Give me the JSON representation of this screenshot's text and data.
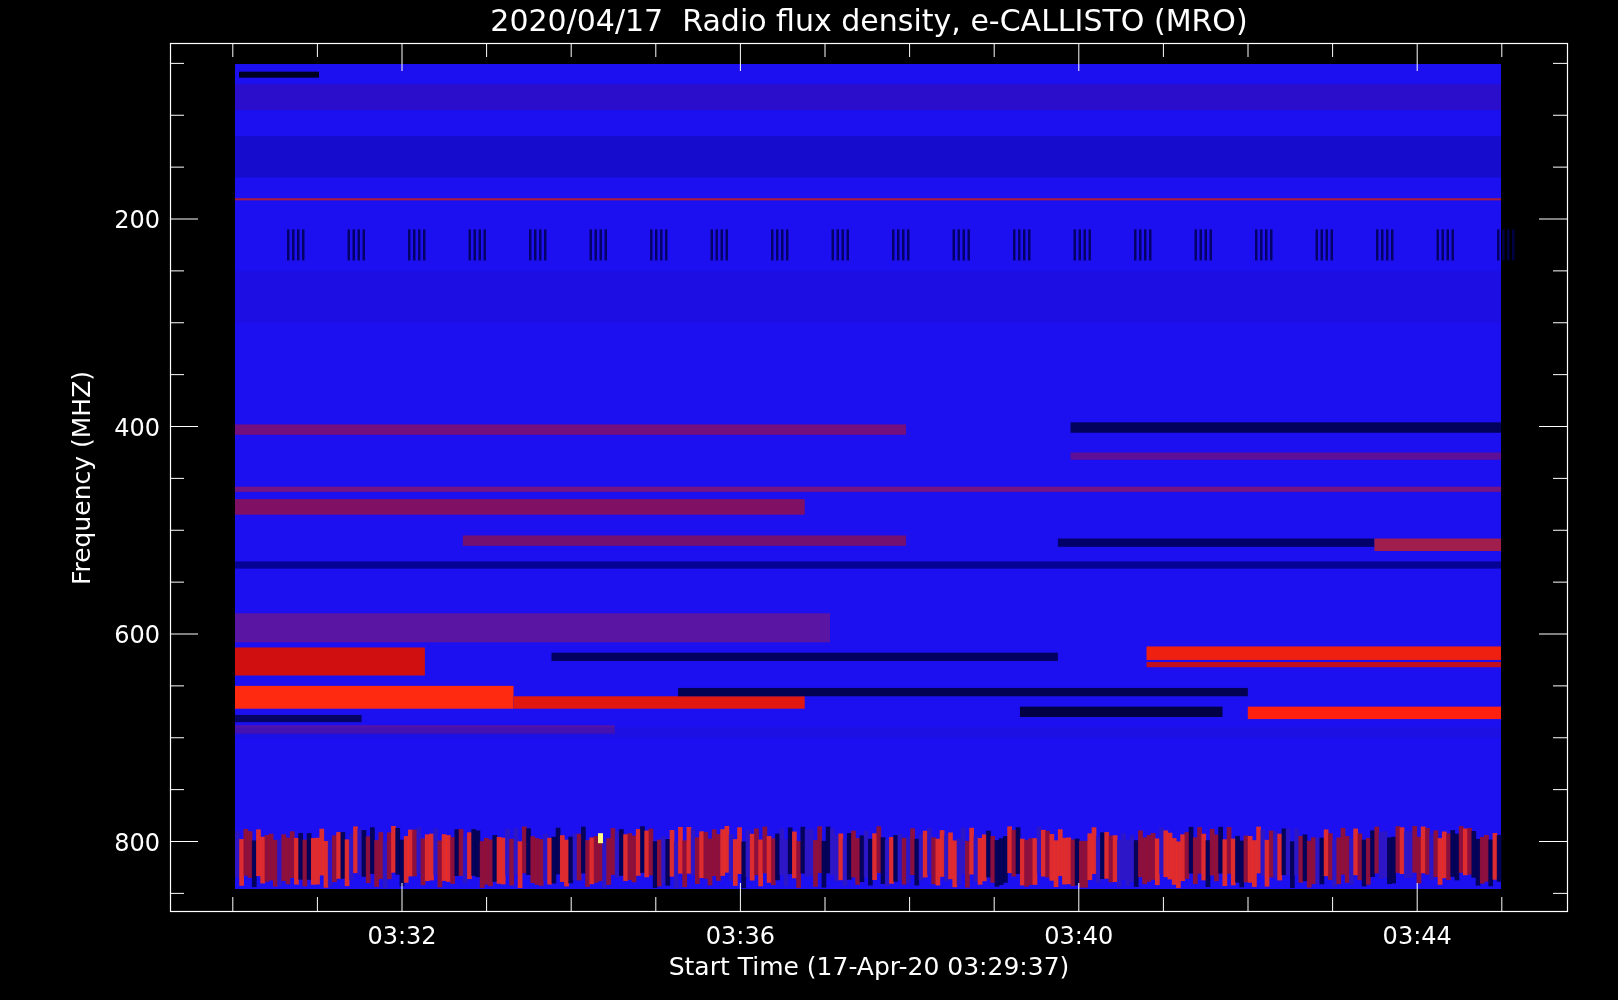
{
  "title": "2020/04/17  Radio flux density, e-CALLISTO (MRO)",
  "y_axis": {
    "label": "Frequency (MHZ)",
    "ticks": [
      "200",
      "400",
      "600",
      "800"
    ]
  },
  "x_axis": {
    "label": "Start Time (17-Apr-20 03:29:37)",
    "ticks": [
      "03:32",
      "03:36",
      "03:40",
      "03:44"
    ]
  }
}
